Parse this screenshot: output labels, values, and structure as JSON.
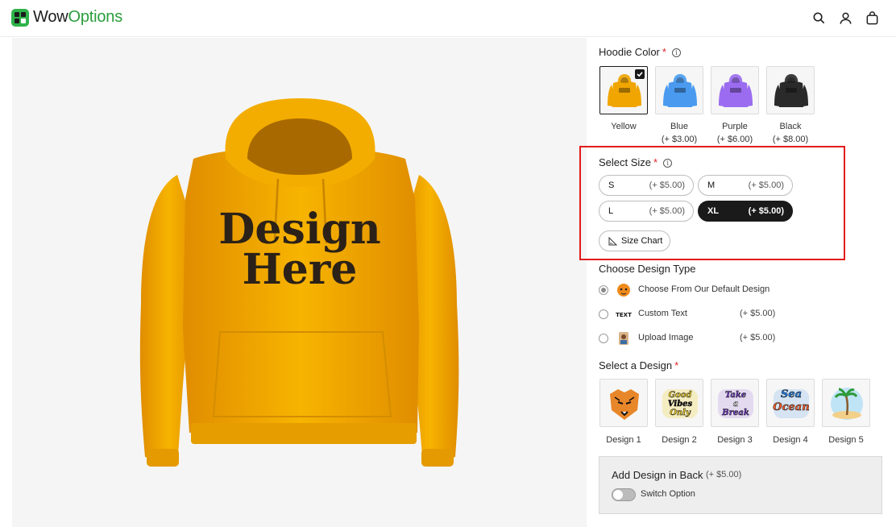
{
  "brand": {
    "name_part1": "Wow",
    "name_part2": "Options"
  },
  "header_icons": [
    "search-icon",
    "user-icon",
    "bag-icon"
  ],
  "product_image": {
    "line1": "Design",
    "line2": "Here"
  },
  "hoodie_color": {
    "title": "Hoodie Color",
    "required_mark": "*",
    "options": [
      {
        "label": "Yellow",
        "price": "",
        "color": "#f0a500",
        "selected": true
      },
      {
        "label": "Blue",
        "price": "(+ $3.00)",
        "color": "#4a9bf0",
        "selected": false
      },
      {
        "label": "Purple",
        "price": "(+ $6.00)",
        "color": "#9b6cf0",
        "selected": false
      },
      {
        "label": "Black",
        "price": "(+ $8.00)",
        "color": "#2a2a2a",
        "selected": false
      }
    ]
  },
  "select_size": {
    "title": "Select Size",
    "required_mark": "*",
    "options": [
      {
        "label": "S",
        "price": "(+ $5.00)",
        "selected": false
      },
      {
        "label": "M",
        "price": "(+ $5.00)",
        "selected": false
      },
      {
        "label": "L",
        "price": "(+ $5.00)",
        "selected": false
      },
      {
        "label": "XL",
        "price": "(+ $5.00)",
        "selected": true
      }
    ],
    "size_chart_label": "Size Chart"
  },
  "design_type": {
    "title": "Choose Design Type",
    "options": [
      {
        "label": "Choose From Our Default Design",
        "price": "",
        "selected": true,
        "icon": "tiger-icon"
      },
      {
        "label": "Custom Text",
        "price": "(+ $5.00)",
        "selected": false,
        "icon": "text-icon",
        "icon_text": "TEXT"
      },
      {
        "label": "Upload Image",
        "price": "(+ $5.00)",
        "selected": false,
        "icon": "photo-icon"
      }
    ]
  },
  "select_design": {
    "title": "Select a Design",
    "required_mark": "*",
    "options": [
      {
        "label": "Design 1",
        "icon": "tiger-design-icon"
      },
      {
        "label": "Design 2",
        "icon": "good-vibes-design-icon",
        "art_text": [
          "Good",
          "Vibes",
          "Only"
        ]
      },
      {
        "label": "Design 3",
        "icon": "take-a-break-design-icon",
        "art_text": [
          "Take",
          "a",
          "Break"
        ]
      },
      {
        "label": "Design 4",
        "icon": "sea-design-icon",
        "art_text": [
          "Sea",
          "Ocean"
        ]
      },
      {
        "label": "Design 5",
        "icon": "palm-island-design-icon"
      }
    ]
  },
  "back_design": {
    "title": "Add Design in Back",
    "price": "(+ $5.00)",
    "switch_label": "Switch Option",
    "enabled": false
  },
  "colors": {
    "highlight": "#e21b1b",
    "accent": "#2a9d3c",
    "selected": "#1a1a1a"
  }
}
